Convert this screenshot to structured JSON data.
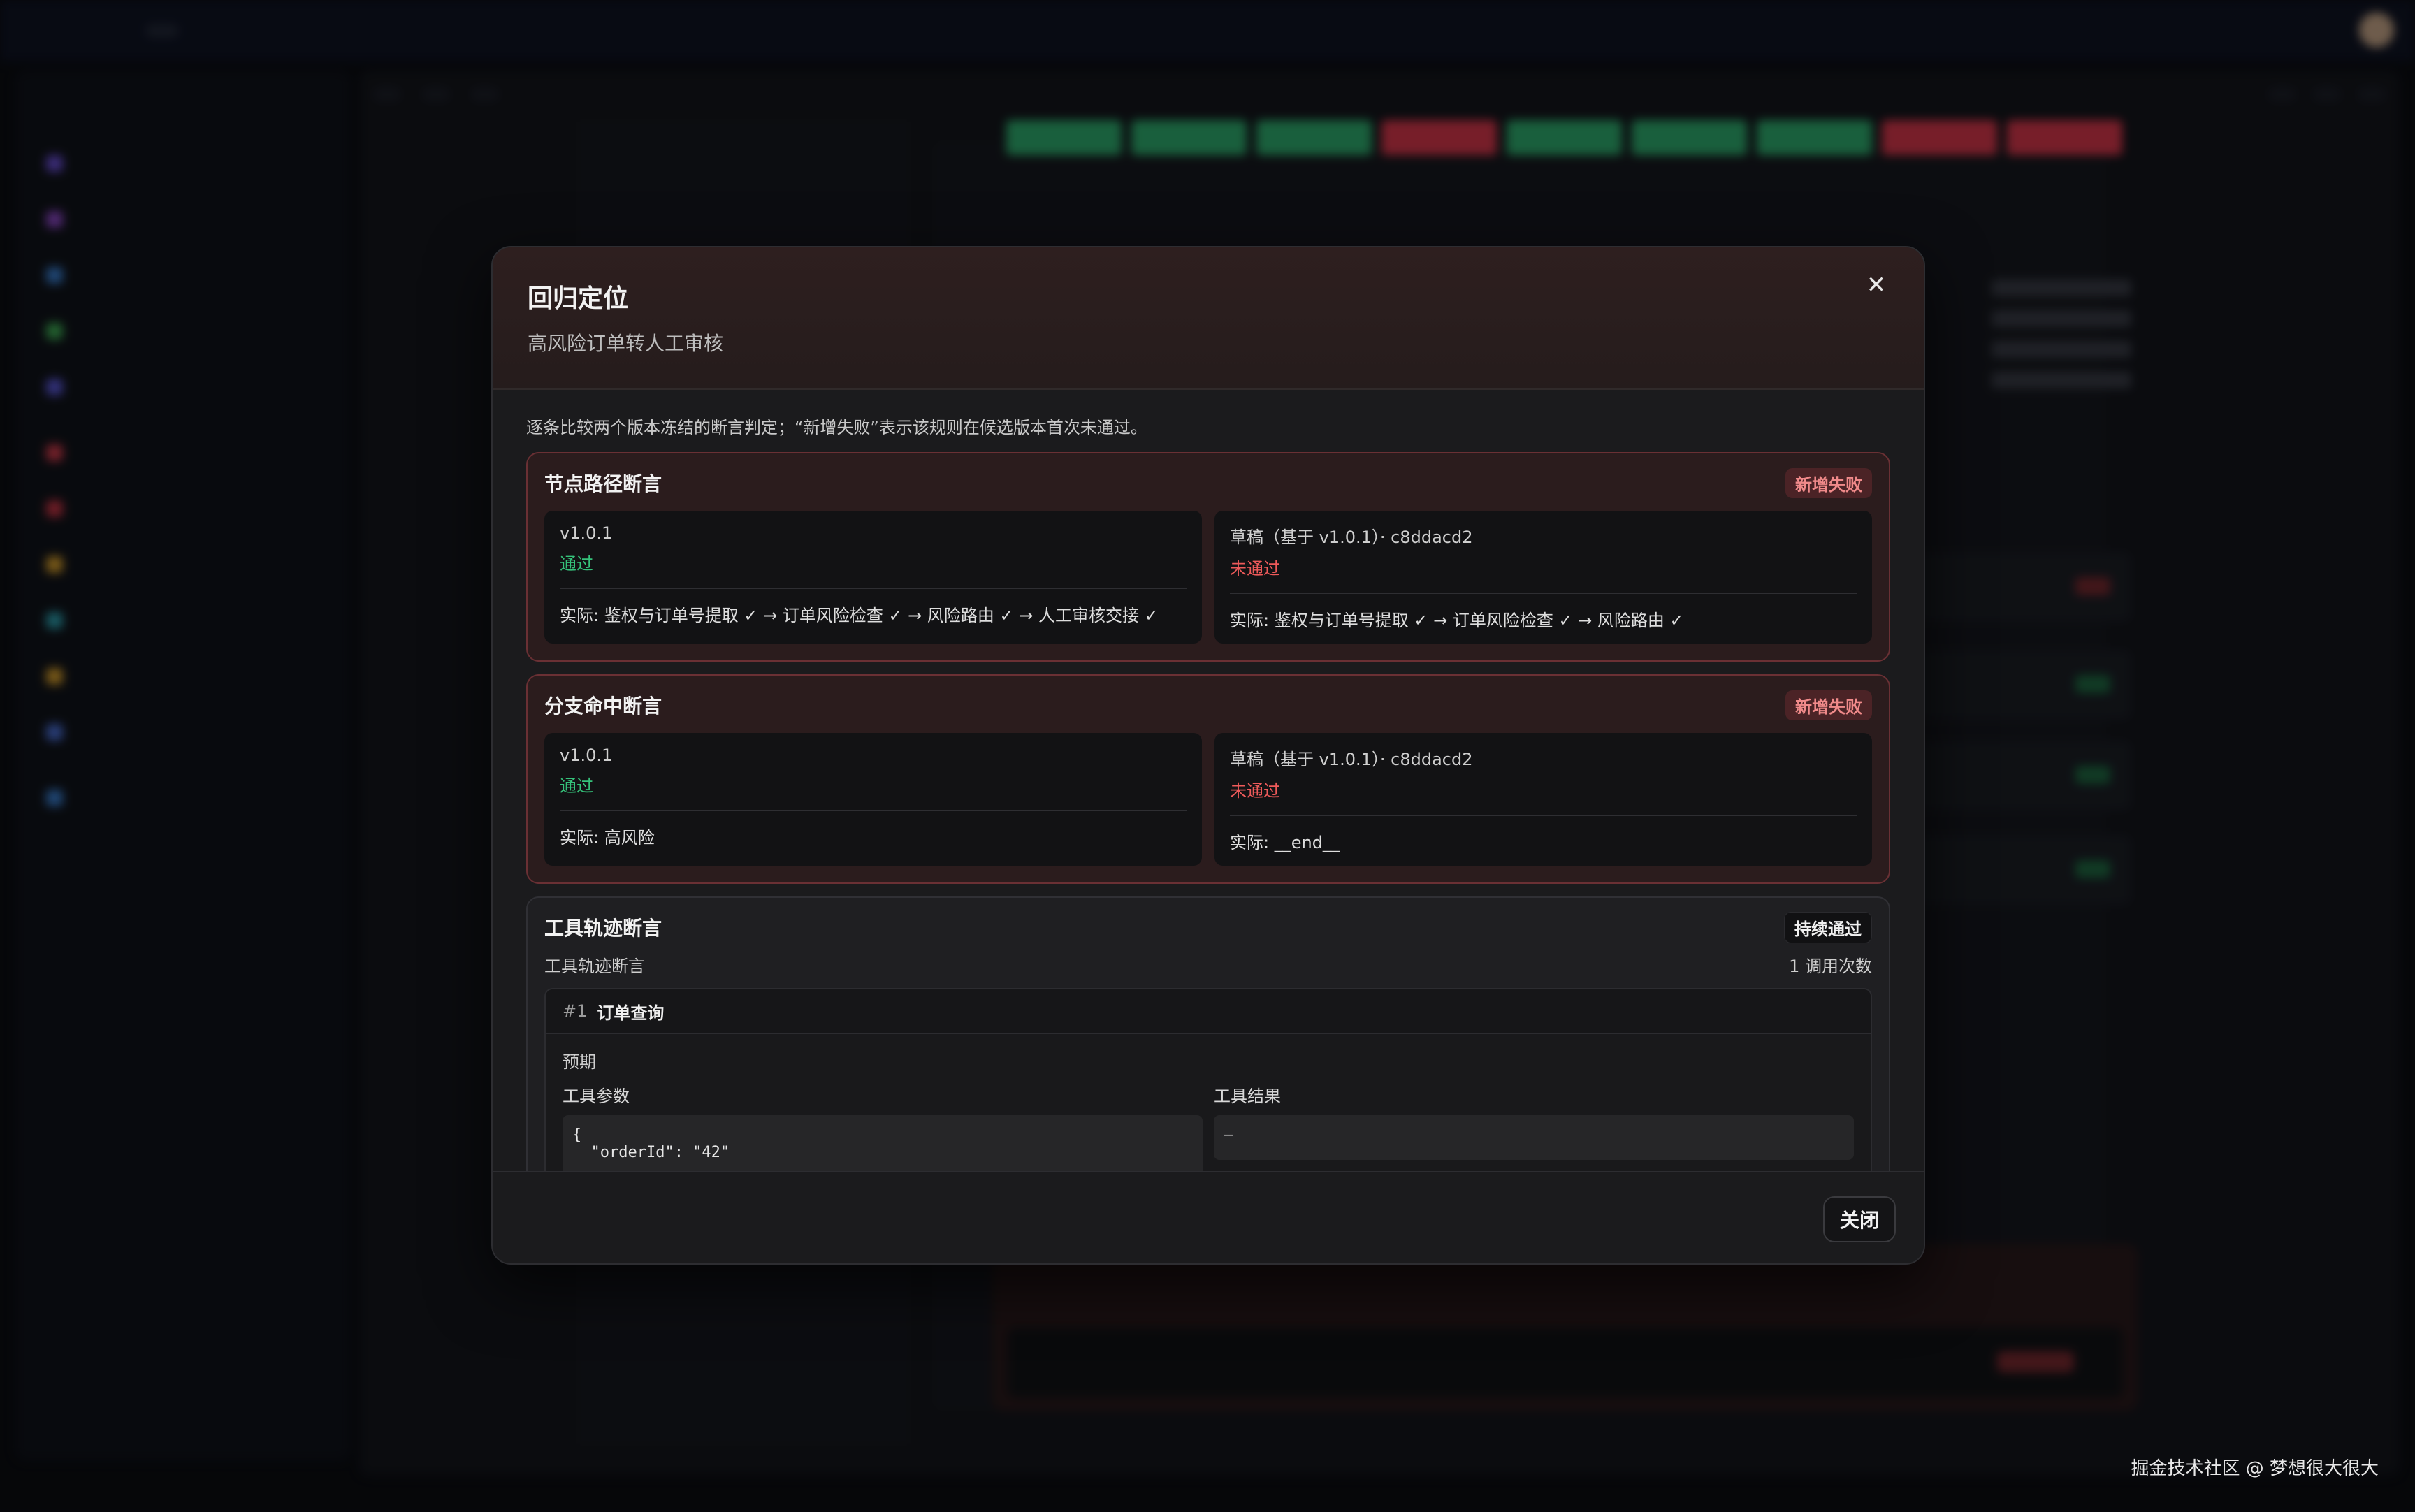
{
  "modal": {
    "title": "回归定位",
    "subtitle": "高风险订单转人工审核",
    "close_icon": "close-icon",
    "description": "逐条比较两个版本冻结的断言判定；“新增失败”表示该规则在候选版本首次未通过。",
    "sections": [
      {
        "title": "节点路径断言",
        "badge": "新增失败",
        "left": {
          "version": "v1.0.1",
          "status": "通过",
          "actual": "实际: 鉴权与订单号提取 ✓ → 订单风险检查 ✓ → 风险路由 ✓ → 人工审核交接 ✓"
        },
        "right": {
          "version": "草稿（基于 v1.0.1）· c8ddacd2",
          "status": "未通过",
          "actual": "实际: 鉴权与订单号提取 ✓ → 订单风险检查 ✓ → 风险路由 ✓"
        }
      },
      {
        "title": "分支命中断言",
        "badge": "新增失败",
        "left": {
          "version": "v1.0.1",
          "status": "通过",
          "actual": "实际: 高风险"
        },
        "right": {
          "version": "草稿（基于 v1.0.1）· c8ddacd2",
          "status": "未通过",
          "actual": "实际: __end__"
        }
      }
    ],
    "tool_section": {
      "title": "工具轨迹断言",
      "badge": "持续通过",
      "sub_label": "工具轨迹断言",
      "call_count": "1 调用次数",
      "call": {
        "num": "#1",
        "name": "订单查询",
        "expected_label": "预期",
        "params_label": "工具参数",
        "result_label": "工具结果",
        "params_code": "{\n  \"orderId\": \"42\"",
        "result_code": "—"
      }
    },
    "footer": {
      "close_label": "关闭"
    }
  },
  "watermark": "掘金技术社区 @ 梦想很大很大",
  "colors": {
    "pass": "#35c27a",
    "fail": "#ee5a5a",
    "badge_fail_bg": "#4b2326",
    "bar_green": "#2fae6f",
    "bar_red": "#d9384c"
  }
}
